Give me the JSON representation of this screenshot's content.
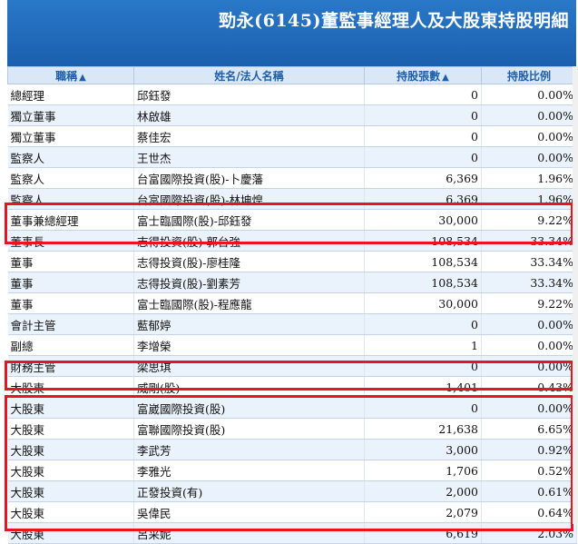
{
  "title": "勁永(6145)董監事經理人及大股東持股明細",
  "columns": [
    {
      "label": "職稱",
      "sort": "▲"
    },
    {
      "label": "姓名/法人名稱",
      "sort": ""
    },
    {
      "label": "持股張數",
      "sort": "▲"
    },
    {
      "label": "持股比例",
      "sort": ""
    }
  ],
  "rows": [
    {
      "title": "總經理",
      "name": "邱鈺發",
      "shares": "0",
      "pct": "0.00%"
    },
    {
      "title": "獨立董事",
      "name": "林啟雄",
      "shares": "0",
      "pct": "0.00%"
    },
    {
      "title": "獨立董事",
      "name": "蔡佳宏",
      "shares": "0",
      "pct": "0.00%"
    },
    {
      "title": "監察人",
      "name": "王世杰",
      "shares": "0",
      "pct": "0.00%"
    },
    {
      "title": "監察人",
      "name": "台富國際投資(股)-卜慶藩",
      "shares": "6,369",
      "pct": "1.96%"
    },
    {
      "title": "監察人",
      "name": "台富國際投資(股)-林坤煌",
      "shares": "6,369",
      "pct": "1.96%"
    },
    {
      "title": "董事兼總經理",
      "name": "富士臨國際(股)-邱鈺發",
      "shares": "30,000",
      "pct": "9.22%"
    },
    {
      "title": "董事長",
      "name": "志得投資(股)-郭台強",
      "shares": "108,534",
      "pct": "33.34%"
    },
    {
      "title": "董事",
      "name": "志得投資(股)-廖桂隆",
      "shares": "108,534",
      "pct": "33.34%"
    },
    {
      "title": "董事",
      "name": "志得投資(股)-劉素芳",
      "shares": "108,534",
      "pct": "33.34%"
    },
    {
      "title": "董事",
      "name": "富士臨國際(股)-程應龍",
      "shares": "30,000",
      "pct": "9.22%"
    },
    {
      "title": "會計主管",
      "name": "藍郁婷",
      "shares": "0",
      "pct": "0.00%"
    },
    {
      "title": "副總",
      "name": "李增榮",
      "shares": "1",
      "pct": "0.00%"
    },
    {
      "title": "財務主管",
      "name": "梁思琪",
      "shares": "0",
      "pct": "0.00%"
    },
    {
      "title": "大股東",
      "name": "威剛(股)",
      "shares": "1,401",
      "pct": "0.43%"
    },
    {
      "title": "大股東",
      "name": "富崴國際投資(股)",
      "shares": "0",
      "pct": "0.00%"
    },
    {
      "title": "大股東",
      "name": "富聯國際投資(股)",
      "shares": "21,638",
      "pct": "6.65%"
    },
    {
      "title": "大股東",
      "name": "李武芳",
      "shares": "3,000",
      "pct": "0.92%"
    },
    {
      "title": "大股東",
      "name": "李雅光",
      "shares": "1,706",
      "pct": "0.52%"
    },
    {
      "title": "大股東",
      "name": "正發投資(有)",
      "shares": "2,000",
      "pct": "0.61%"
    },
    {
      "title": "大股東",
      "name": "吳偉民",
      "shares": "2,079",
      "pct": "0.64%"
    },
    {
      "title": "大股東",
      "name": "呂采妮",
      "shares": "6,619",
      "pct": "2.03%"
    }
  ],
  "colors": {
    "header_bg": "#1a5fae",
    "column_header_text": "#1f5fa8",
    "highlight": "#e8141f"
  }
}
